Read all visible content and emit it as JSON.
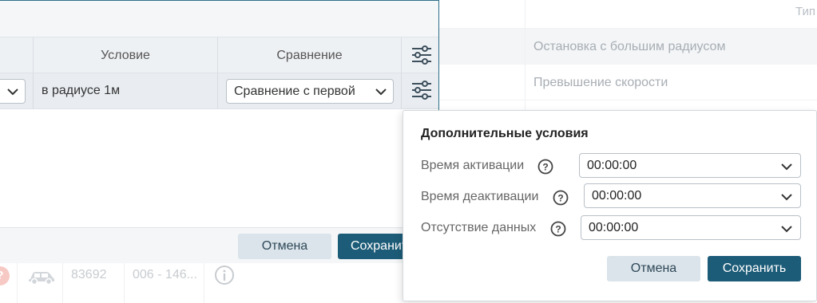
{
  "background": {
    "column_header": "Тип",
    "rows": [
      "Остановка с большим радиусом",
      "Превышение скорости"
    ],
    "bottom_row": {
      "badge": "?",
      "id": "83692",
      "plate": "006 - 146..."
    }
  },
  "modal": {
    "columns": [
      "Условие",
      "Сравнение"
    ],
    "row": {
      "condition": "в радиусе 1м",
      "comparison": "Сравнение с первой"
    },
    "footer": {
      "cancel": "Отмена",
      "save": "Сохранить"
    }
  },
  "popover": {
    "title": "Дополнительные условия",
    "fields": [
      {
        "label": "Время активации",
        "value": "00:00:00"
      },
      {
        "label": "Время деактивации",
        "value": "00:00:00"
      },
      {
        "label": "Отсутствие данных",
        "value": "00:00:00"
      }
    ],
    "cancel": "Отмена",
    "save": "Сохранить"
  },
  "colors": {
    "primary": "#1d5c78",
    "secondary": "#dbe4ea",
    "border_accent": "#2f6f87"
  }
}
